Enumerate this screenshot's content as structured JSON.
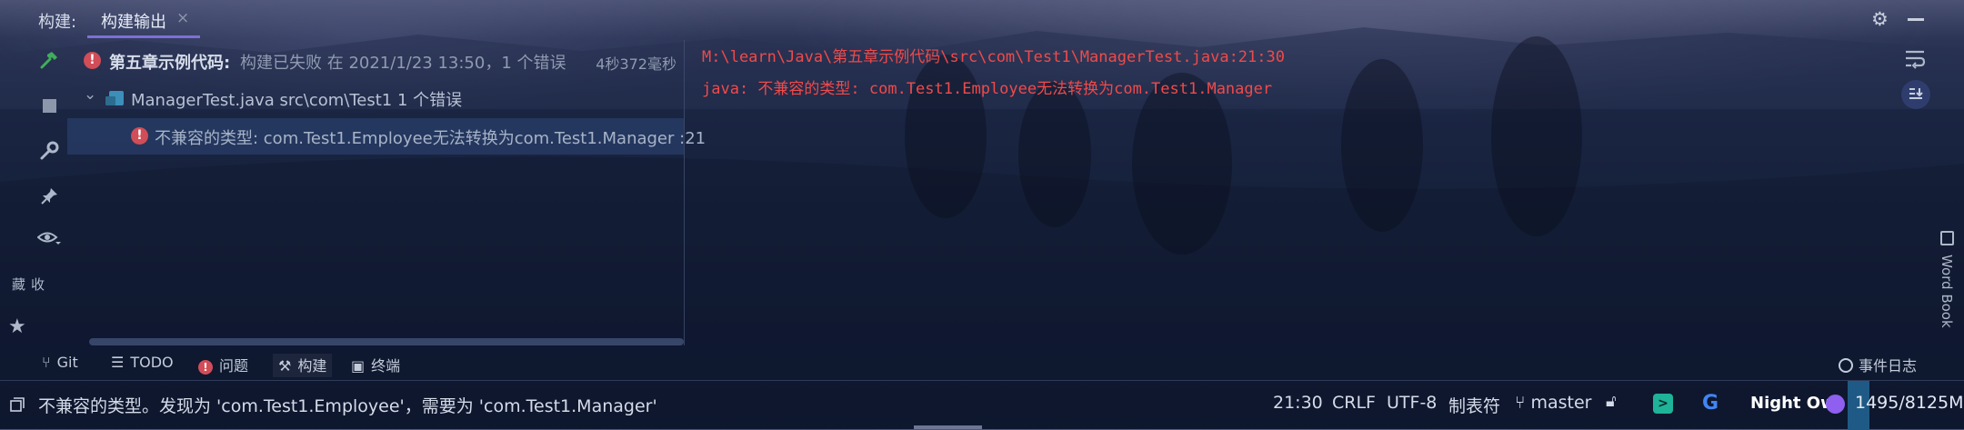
{
  "theme": {
    "accent": "#7e6fd6",
    "error": "#ef4a4a",
    "error_badge": "#d14d57"
  },
  "top_bar": {
    "label": "构建:",
    "tab": "构建输出",
    "tab_close": "×"
  },
  "build_tree": {
    "root": {
      "name": "第五章示例代码:",
      "status": "构建已失败 在 2021/1/23 13:50，1 个错误",
      "duration": "4秒372毫秒"
    },
    "file": {
      "label": "ManagerTest.java src\\com\\Test1 1 个错误"
    },
    "error": {
      "message": "不兼容的类型: com.Test1.Employee无法转换为com.Test1.Manager :21"
    }
  },
  "console": {
    "line1": "M:\\learn\\Java\\第五章示例代码\\src\\com\\Test1\\ManagerTest.java:21:30",
    "line2": "java: 不兼容的类型: com.Test1.Employee无法转换为com.Test1.Manager"
  },
  "side": {
    "bookmarks": "收藏",
    "word_book": "Word Book"
  },
  "tool_tabs": [
    {
      "label": "Git",
      "icon": "git-branch-icon"
    },
    {
      "label": "TODO",
      "icon": "list-icon"
    },
    {
      "label": "问题",
      "icon": "problem-icon"
    },
    {
      "label": "构建",
      "icon": "hammer-icon"
    },
    {
      "label": "终端",
      "icon": "terminal-icon"
    }
  ],
  "event_log": "事件日志",
  "status_bar": {
    "message": "不兼容的类型。发现为 'com.Test1.Employee'，需要为 'com.Test1.Manager'",
    "position": "21:30",
    "line_separator": "CRLF",
    "encoding": "UTF-8",
    "indent": "制表符",
    "branch": "master",
    "theme": "Night Owl",
    "memory": "1495/8125M",
    "memory_used_fraction": 0.184
  }
}
